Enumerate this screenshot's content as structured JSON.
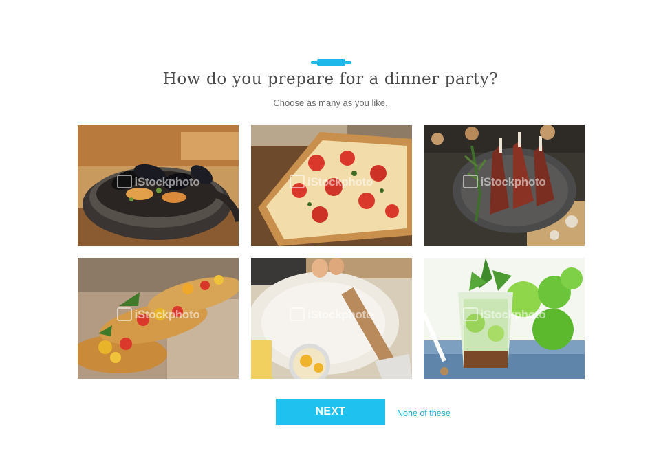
{
  "brand": {
    "accent_color": "#1fc1ee",
    "logo_icon": "rolling-pin-icon"
  },
  "question": {
    "title": "How do you prepare for a dinner party?",
    "subtitle": "Choose as many as you like."
  },
  "options": [
    {
      "name": "mussels",
      "watermark": "iStockphoto"
    },
    {
      "name": "pizza",
      "watermark": "iStockphoto"
    },
    {
      "name": "lamb-chops",
      "watermark": "iStockphoto"
    },
    {
      "name": "bruschetta",
      "watermark": "iStockphoto"
    },
    {
      "name": "baking-flour",
      "watermark": "iStockphoto"
    },
    {
      "name": "mojito",
      "watermark": "iStockphoto"
    }
  ],
  "actions": {
    "next_label": "NEXT",
    "none_label": "None of these"
  }
}
